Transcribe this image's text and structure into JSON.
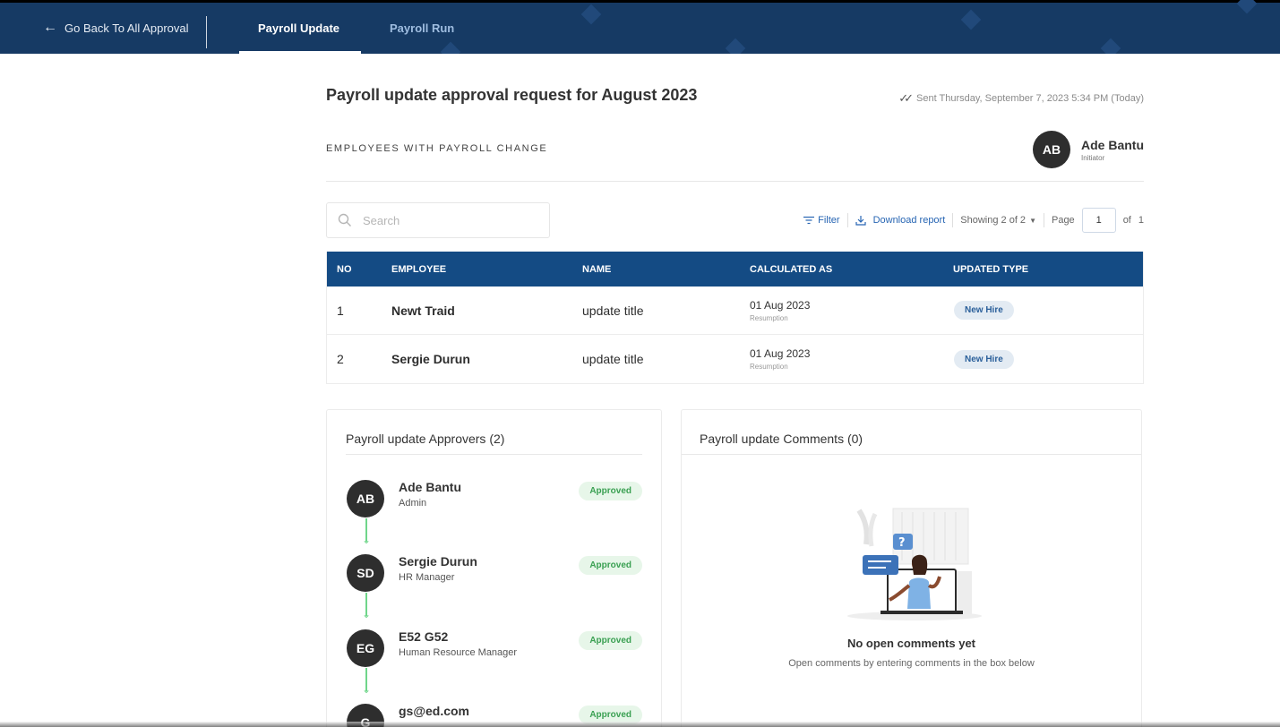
{
  "nav": {
    "back_label": "Go Back To All Approval",
    "tabs": [
      {
        "label": "Payroll Update",
        "active": true
      },
      {
        "label": "Payroll Run",
        "active": false
      }
    ]
  },
  "header": {
    "title": "Payroll update approval request for August 2023",
    "sent": "Sent Thursday, September 7, 2023 5:34 PM (Today)",
    "section_label": "EMPLOYEES WITH PAYROLL CHANGE",
    "initiator": {
      "initials": "AB",
      "name": "Ade Bantu",
      "role": "Initiator"
    }
  },
  "toolbar": {
    "search_placeholder": "Search",
    "filter_label": "Filter",
    "download_label": "Download report",
    "showing": "Showing 2 of 2",
    "page_label": "Page",
    "page_value": "1",
    "of_label": "of",
    "total_pages": "1"
  },
  "table": {
    "columns": [
      "NO",
      "EMPLOYEE",
      "NAME",
      "CALCULATED AS",
      "UPDATED TYPE"
    ],
    "rows": [
      {
        "no": "1",
        "employee": "Newt Traid",
        "name": "update title",
        "date": "01 Aug 2023",
        "date_sub": "Resumption",
        "type": "New Hire"
      },
      {
        "no": "2",
        "employee": "Sergie Durun",
        "name": "update title",
        "date": "01 Aug 2023",
        "date_sub": "Resumption",
        "type": "New Hire"
      }
    ]
  },
  "approvers": {
    "title": "Payroll update Approvers (2)",
    "items": [
      {
        "initials": "AB",
        "name": "Ade Bantu",
        "role": "Admin",
        "status": "Approved"
      },
      {
        "initials": "SD",
        "name": "Sergie Durun",
        "role": "HR Manager",
        "status": "Approved"
      },
      {
        "initials": "EG",
        "name": "E52 G52",
        "role": "Human Resource Manager",
        "status": "Approved"
      },
      {
        "initials": "G",
        "name": "gs@ed.com",
        "role": "",
        "status": "Approved"
      }
    ]
  },
  "comments": {
    "title": "Payroll update Comments (0)",
    "empty_title": "No open comments yet",
    "empty_sub": "Open comments by entering comments in the box below",
    "question_mark": "?"
  },
  "colors": {
    "nav_bg": "#163a64",
    "table_header": "#144b84",
    "link": "#2765b3",
    "approved_green": "#3aa052",
    "connector_green": "#6fd68a"
  }
}
